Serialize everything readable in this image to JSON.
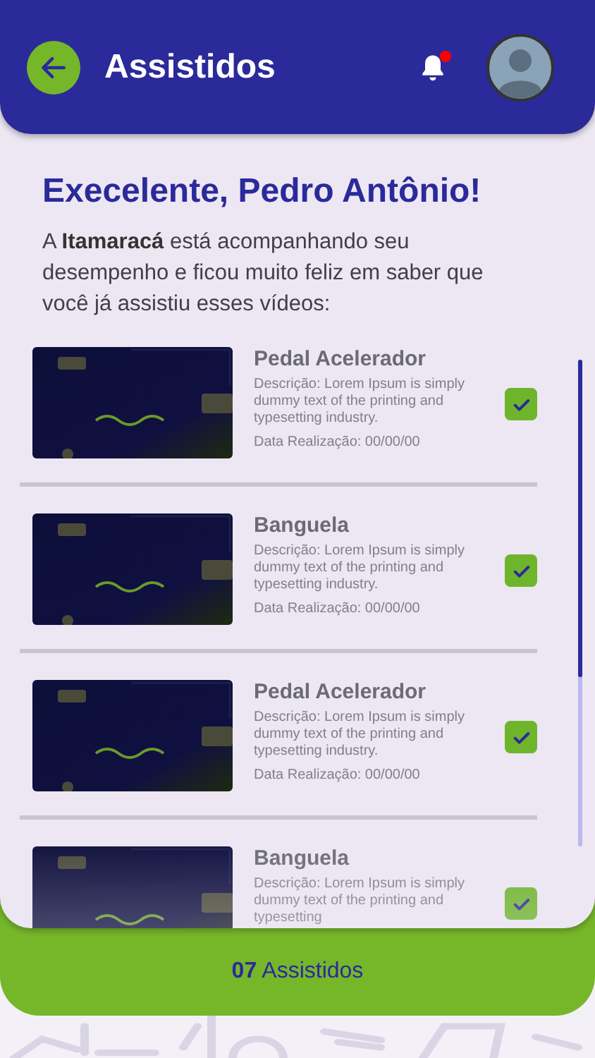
{
  "header": {
    "title": "Assistidos",
    "notification_unread": true
  },
  "greeting": "Execelente, Pedro Antônio!",
  "intro": "A **Itamaracá** está acompanhando seu desempenho e ficou muito feliz em saber que você já assistiu esses vídeos:",
  "videos": [
    {
      "title": "Pedal Acelerador",
      "description": "Descrição: Lorem Ipsum is simply dummy text of the printing and typesetting industry.",
      "date": "Data Realização: 00/00/00",
      "checked": true
    },
    {
      "title": "Banguela",
      "description": "Descrição: Lorem Ipsum is simply dummy text of the printing and typesetting industry.",
      "date": "Data Realização: 00/00/00",
      "checked": true
    },
    {
      "title": "Pedal Acelerador",
      "description": "Descrição: Lorem Ipsum is simply dummy text of the printing and typesetting industry.",
      "date": "Data Realização: 00/00/00",
      "checked": true
    },
    {
      "title": "Banguela",
      "description": "Descrição: Lorem Ipsum is simply dummy text of the printing and typesetting",
      "checked": true
    }
  ],
  "footer": {
    "summary": "**07** Assistidos"
  }
}
